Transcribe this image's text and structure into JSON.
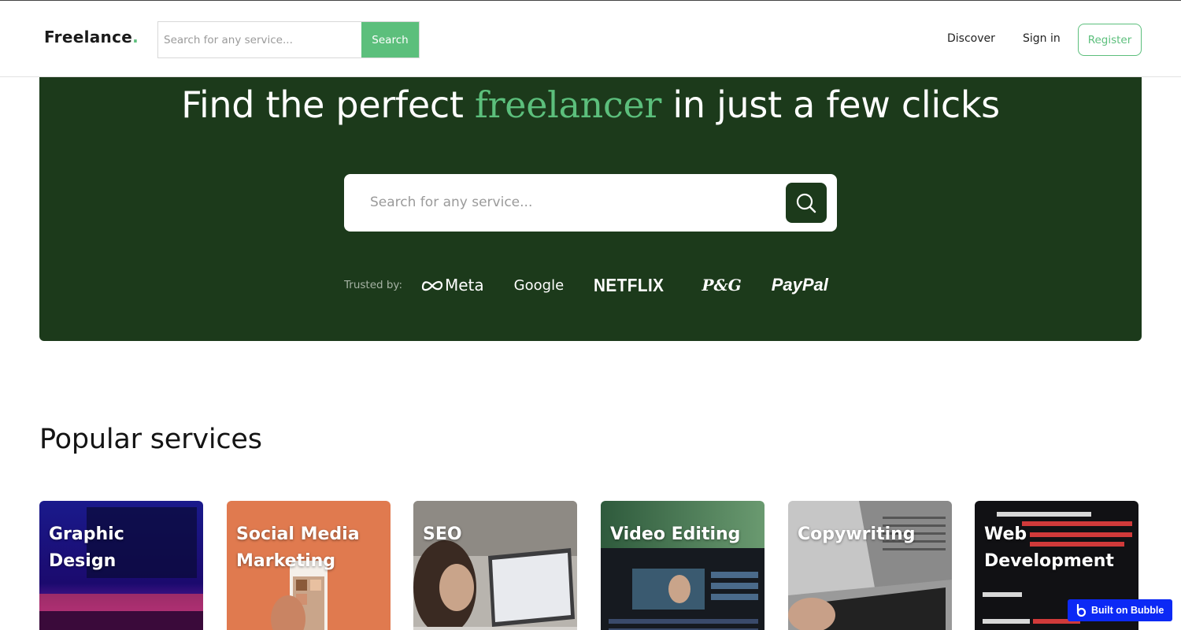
{
  "header": {
    "logo_text": "Freelance",
    "logo_dot": ".",
    "search_placeholder": "Search for any service...",
    "search_button": "Search",
    "nav_discover": "Discover",
    "nav_signin": "Sign in",
    "register_button": "Register"
  },
  "hero": {
    "title_before": "Find the perfect ",
    "title_accent": "freelancer",
    "title_after": " in just a few clicks",
    "search_placeholder": "Search for any service...",
    "trusted_label": "Trusted by:",
    "brands": [
      "Meta",
      "Google",
      "NETFLIX",
      "P&G",
      "PayPal"
    ]
  },
  "services": {
    "title": "Popular services",
    "items": [
      {
        "label": "Graphic Design"
      },
      {
        "label": "Social Media Marketing"
      },
      {
        "label": "SEO"
      },
      {
        "label": "Video Editing"
      },
      {
        "label": "Copywriting"
      },
      {
        "label": "Web Development"
      }
    ]
  },
  "badge": {
    "label": "Built on Bubble"
  },
  "colors": {
    "accent_green": "#5cbf7c",
    "hero_dark_green": "#1c3a1b",
    "bubble_blue": "#0c29f5"
  }
}
